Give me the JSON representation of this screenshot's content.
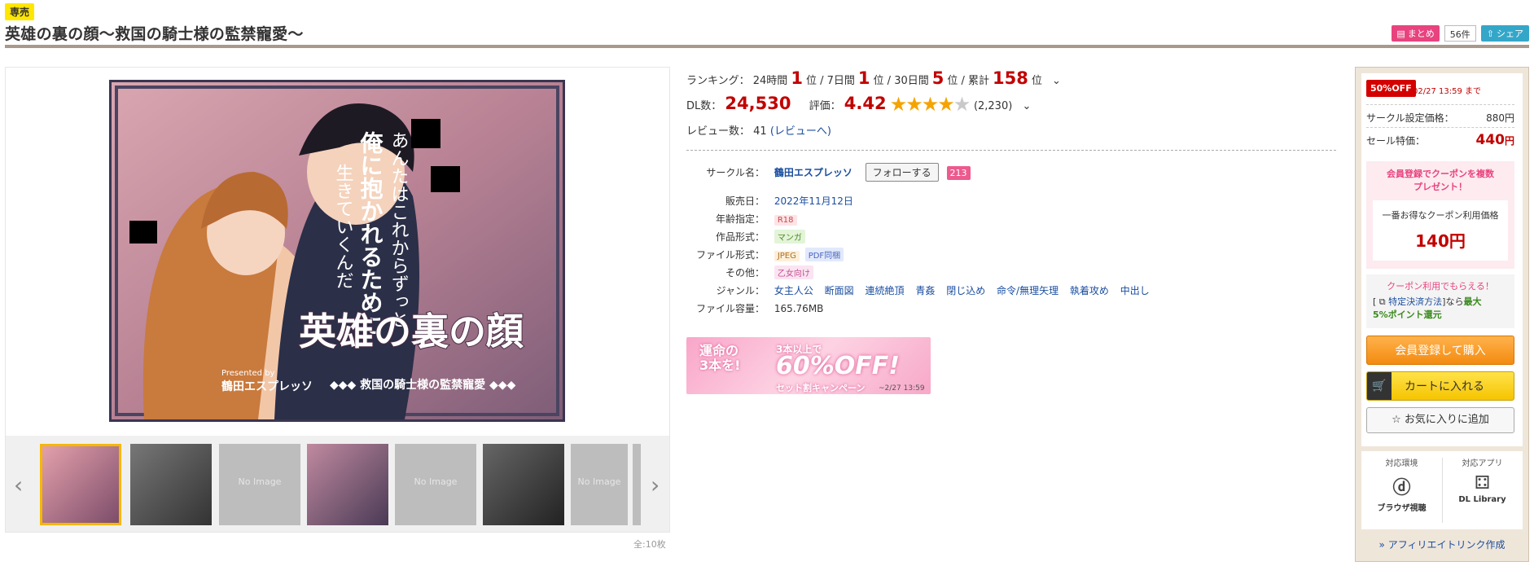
{
  "header": {
    "exclusive_badge": "専売",
    "title": "英雄の裏の顔～救国の騎士様の監禁寵愛～",
    "matome_label": "まとめ",
    "matome_count": "56件",
    "share_label": "シェア"
  },
  "gallery": {
    "cover_title": "英雄の裏の顔",
    "cover_subtitle": "救国の騎士様の監禁寵愛",
    "cover_tagline": "あんたはこれからずっと俺に抱かれるために生きていくんだ",
    "cover_presented": "Presented by",
    "cover_circle": "鶴田エスプレッソ",
    "no_image": "No Image",
    "count": "全:10枚"
  },
  "ranking": {
    "label": "ランキング：",
    "p24_label": "24時間",
    "p24": "1",
    "p7_label": "7日間",
    "p7": "1",
    "p30_label": "30日間",
    "p30": "5",
    "total_label": "累計",
    "total": "158",
    "unit": "位"
  },
  "stats": {
    "dl_label": "DL数：",
    "dl": "24,530",
    "rating_label": "評価：",
    "rating": "4.42",
    "rating_value": 4.42,
    "rating_count": "(2,230)",
    "review_label": "レビュー数：",
    "review_count": "41",
    "review_link": "(レビューへ)"
  },
  "spec": {
    "circle_label": "サークル名：",
    "circle": "鶴田エスプレッソ",
    "follow": "フォローする",
    "follow_count": "213",
    "release_label": "販売日：",
    "release": "2022年11月12日",
    "age_label": "年齢指定：",
    "age": "R18",
    "form_label": "作品形式：",
    "form": "マンガ",
    "file_label": "ファイル形式：",
    "file1": "JPEG",
    "file2": "PDF同梱",
    "other_label": "その他：",
    "other": "乙女向け",
    "genre_label": "ジャンル：",
    "genres": [
      "女主人公",
      "断面図",
      "連続絶頂",
      "青姦",
      "閉じ込め",
      "命令/無理矢理",
      "執着攻め",
      "中出し"
    ],
    "size_label": "ファイル容量：",
    "size": "165.76MB"
  },
  "campaign": {
    "line1": "運命の",
    "line2": "3本を!",
    "line3": "3本以上で",
    "percent": "60%OFF!",
    "sub": "セット割キャンペーン",
    "date": "~2/27 13:59"
  },
  "buybox": {
    "off_badge": "50%OFF",
    "deadline": "02/27 13:59 まで",
    "set_price_label": "サークル設定価格：",
    "set_price": "880円",
    "sale_label": "セール特価：",
    "sale_price": "440",
    "sale_unit": "円",
    "coupon_head": "会員登録でクーポンを複数\nプレゼント！",
    "coupon_label": "一番お得なクーポン利用価格",
    "coupon_price": "140円",
    "coupon_get_title": "クーポン利用でもらえる！",
    "coupon_get_pre": "[",
    "coupon_get_link": "特定決済方法",
    "coupon_get_mid": "]なら",
    "coupon_get_bold1": "最大",
    "coupon_get_bold2": "5%ポイント還元",
    "register_btn": "会員登録して購入",
    "cart_btn": "カートに入れる",
    "fav_btn": "お気に入りに追加",
    "env_label": "対応環境",
    "env_name": "ブラウザ視聴",
    "app_label": "対応アプリ",
    "app_name": "DL Library",
    "affiliate": "» アフィリエイトリンク作成"
  }
}
